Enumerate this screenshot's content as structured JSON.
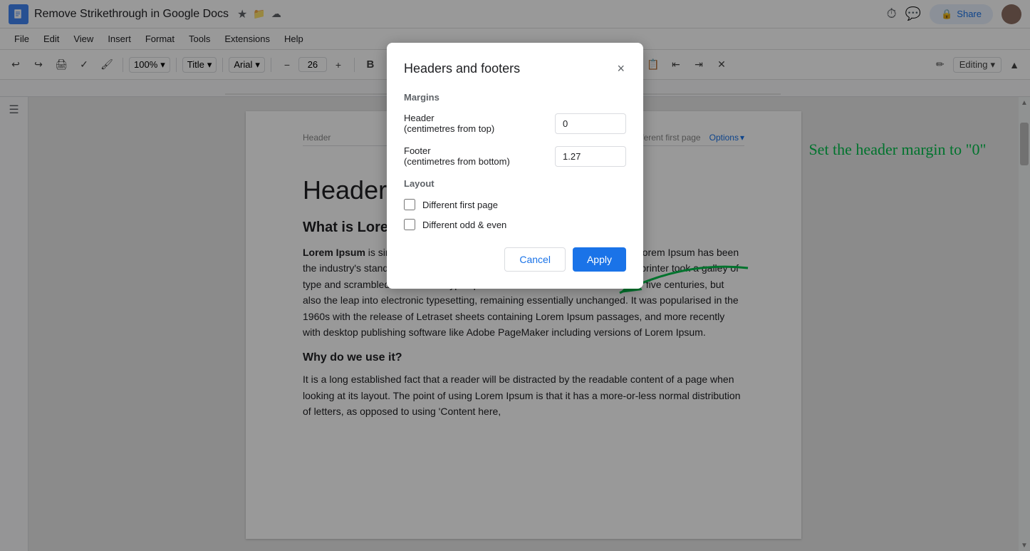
{
  "titleBar": {
    "docTitle": "Remove Strikethrough in Google Docs",
    "shareLabel": "Share"
  },
  "menuBar": {
    "items": [
      "File",
      "Edit",
      "View",
      "Insert",
      "Format",
      "Tools",
      "Extensions",
      "Help"
    ]
  },
  "toolbar": {
    "zoom": "100%",
    "style": "Title",
    "font": "Arial",
    "fontSize": "26",
    "editingMode": "Editing"
  },
  "document": {
    "headerLabel": "Header",
    "differentFirstPage": "Different first page",
    "optionsLabel": "Options",
    "titleText": "Header",
    "h2Text": "What is Lorem",
    "bodyText1Bold": "Lorem Ipsum",
    "bodyText1": " is simply dummy text of the printing and typesetting industry. Lorem Ipsum has been the industry's standard dummy text ever since the 1500s, when an unknown printer took a galley of type and scrambled it to make a type specimen book. It has survived not only five centuries, but also the leap into electronic typesetting, remaining essentially unchanged. It was popularised in the 1960s with the release of Letraset sheets containing Lorem Ipsum passages, and more recently with desktop publishing software like Adobe PageMaker including versions of Lorem Ipsum.",
    "h3Text": "Why do we use it?",
    "bodyText2": "It is a long established fact that a reader will be distracted by the readable content of a page when looking at its layout. The point of using Lorem Ipsum is that it has a more-or-less normal distribution of letters, as opposed to using 'Content here,"
  },
  "modal": {
    "title": "Headers and footers",
    "marginsLabel": "Margins",
    "headerFieldLabel": "Header\n(centimetres from top)",
    "headerFieldLabel1": "Header",
    "headerFieldLabel2": "(centimetres from top)",
    "headerValue": "0",
    "footerFieldLabel": "Footer",
    "footerFieldLabel2": "(centimetres from bottom)",
    "footerValue": "1.27",
    "layoutLabel": "Layout",
    "checkbox1": "Different first page",
    "checkbox2": "Different odd & even",
    "cancelLabel": "Cancel",
    "applyLabel": "Apply"
  },
  "annotation": {
    "text": "Set the header margin to \"0\""
  }
}
